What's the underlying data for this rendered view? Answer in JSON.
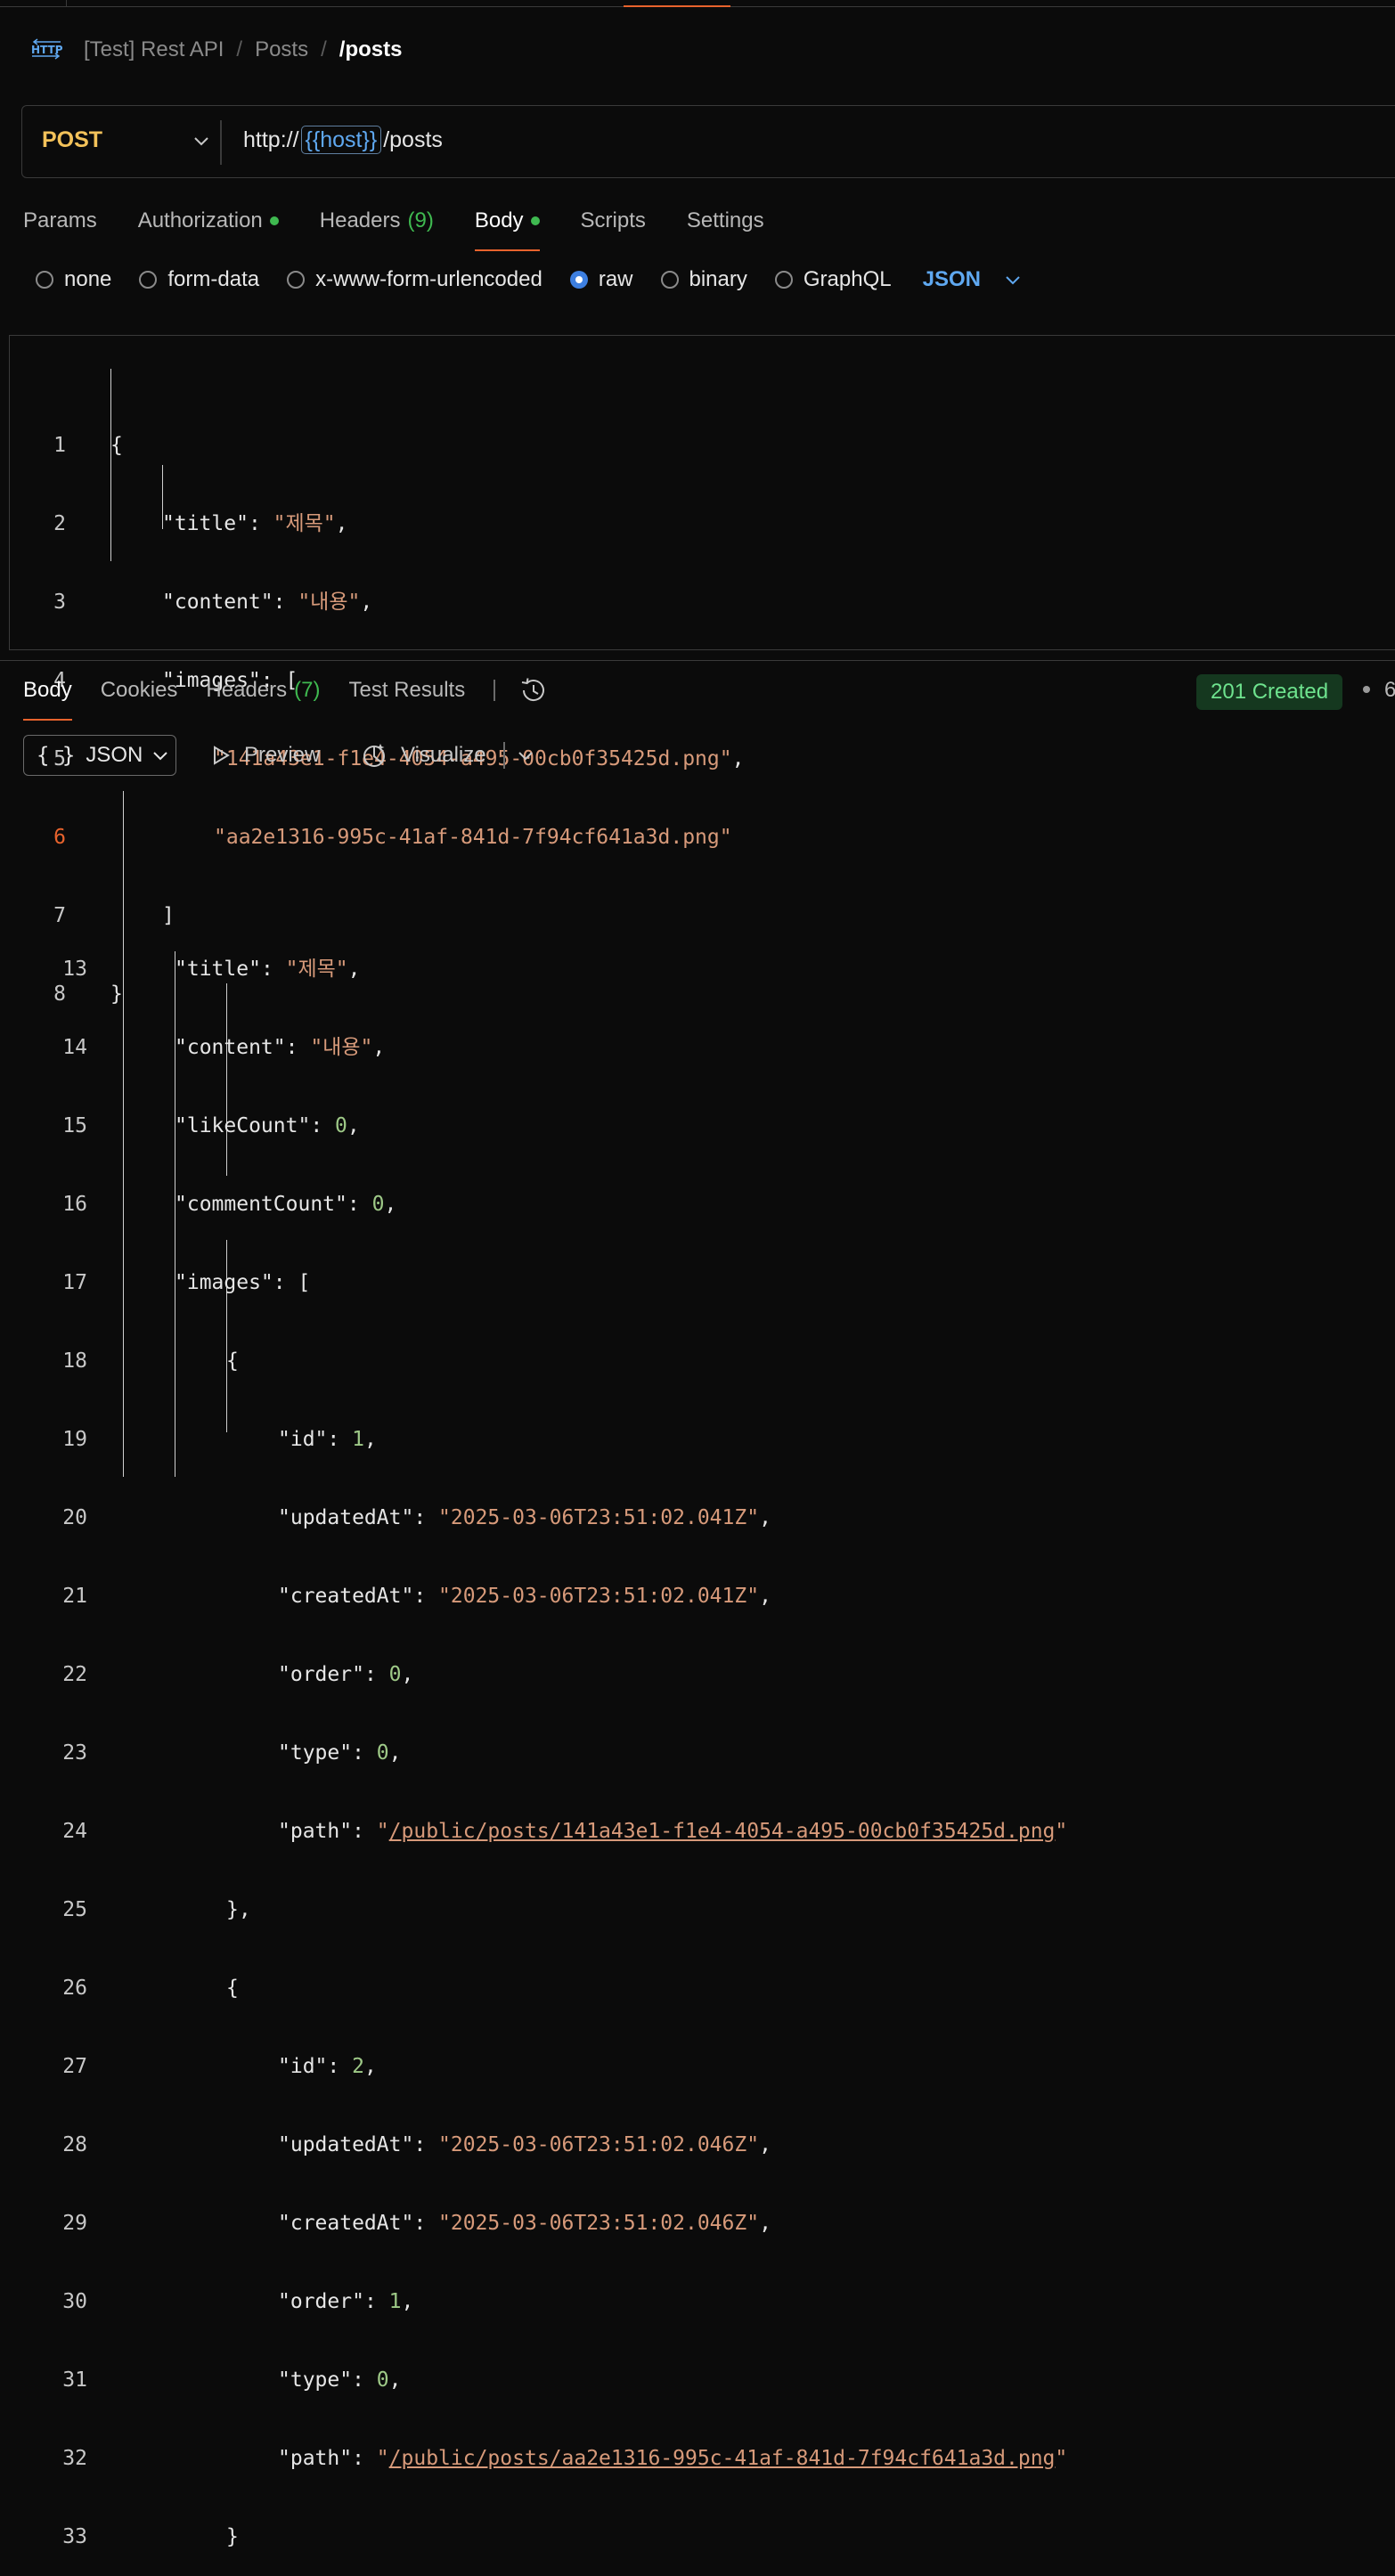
{
  "breadcrumb": {
    "items": [
      "[Test] Rest API",
      "Posts"
    ],
    "separator": "/",
    "current": "/posts"
  },
  "request": {
    "method": "POST",
    "url_prefix": "http://",
    "url_variable": "{{host}}",
    "url_suffix": "/posts"
  },
  "request_tabs": {
    "params": "Params",
    "authorization": "Authorization",
    "headers": "Headers",
    "headers_count": "(9)",
    "body": "Body",
    "scripts": "Scripts",
    "settings": "Settings"
  },
  "body_types": {
    "none": "none",
    "form_data": "form-data",
    "urlencoded": "x-www-form-urlencoded",
    "raw": "raw",
    "binary": "binary",
    "graphql": "GraphQL",
    "selected": "raw",
    "language": "JSON"
  },
  "request_body": {
    "line_numbers": [
      "1",
      "2",
      "3",
      "4",
      "5",
      "6",
      "7",
      "8"
    ],
    "active_line": "6",
    "key_title": "\"title\"",
    "val_title": "\"제목\"",
    "key_content": "\"content\"",
    "val_content": "\"내용\"",
    "key_images": "\"images\"",
    "img1": "\"141a43e1-f1e4-4054-a495-00cb0f35425d.png\"",
    "img2": "\"aa2e1316-995c-41af-841d-7f94cf641a3d.png\""
  },
  "response_tabs": {
    "body": "Body",
    "cookies": "Cookies",
    "headers": "Headers",
    "headers_count": "(7)",
    "test_results": "Test Results",
    "status": "201 Created",
    "trailing": "6"
  },
  "response_toolbar": {
    "format_braces": "{ }",
    "format": "JSON",
    "preview": "Preview",
    "visualize": "Visualize"
  },
  "response_body": {
    "line_numbers": [
      "13",
      "14",
      "15",
      "16",
      "17",
      "18",
      "19",
      "20",
      "21",
      "22",
      "23",
      "24",
      "25",
      "26",
      "27",
      "28",
      "29",
      "30",
      "31",
      "32",
      "33"
    ],
    "key_title": "\"title\"",
    "val_title": "\"제목\"",
    "key_content": "\"content\"",
    "val_content": "\"내용\"",
    "key_likeCount": "\"likeCount\"",
    "val_likeCount": "0",
    "key_commentCount": "\"commentCount\"",
    "val_commentCount": "0",
    "key_images": "\"images\"",
    "key_id": "\"id\"",
    "key_updatedAt": "\"updatedAt\"",
    "key_createdAt": "\"createdAt\"",
    "key_order": "\"order\"",
    "key_type": "\"type\"",
    "key_path": "\"path\"",
    "img1_id": "1",
    "img1_updatedAt": "\"2025-03-06T23:51:02.041Z\"",
    "img1_createdAt": "\"2025-03-06T23:51:02.041Z\"",
    "img1_order": "0",
    "img1_type": "0",
    "img1_path": "/public/posts/141a43e1-f1e4-4054-a495-00cb0f35425d.png",
    "img2_id": "2",
    "img2_updatedAt": "\"2025-03-06T23:51:02.046Z\"",
    "img2_createdAt": "\"2025-03-06T23:51:02.046Z\"",
    "img2_order": "1",
    "img2_type": "0",
    "img2_path": "/public/posts/aa2e1316-995c-41af-841d-7f94cf641a3d.png"
  },
  "colors": {
    "accent": "#e8632d",
    "method": "#f3c25a",
    "success": "#3fb950",
    "link": "#5fa8f0",
    "string": "#d79a7a",
    "number": "#9ec987"
  }
}
